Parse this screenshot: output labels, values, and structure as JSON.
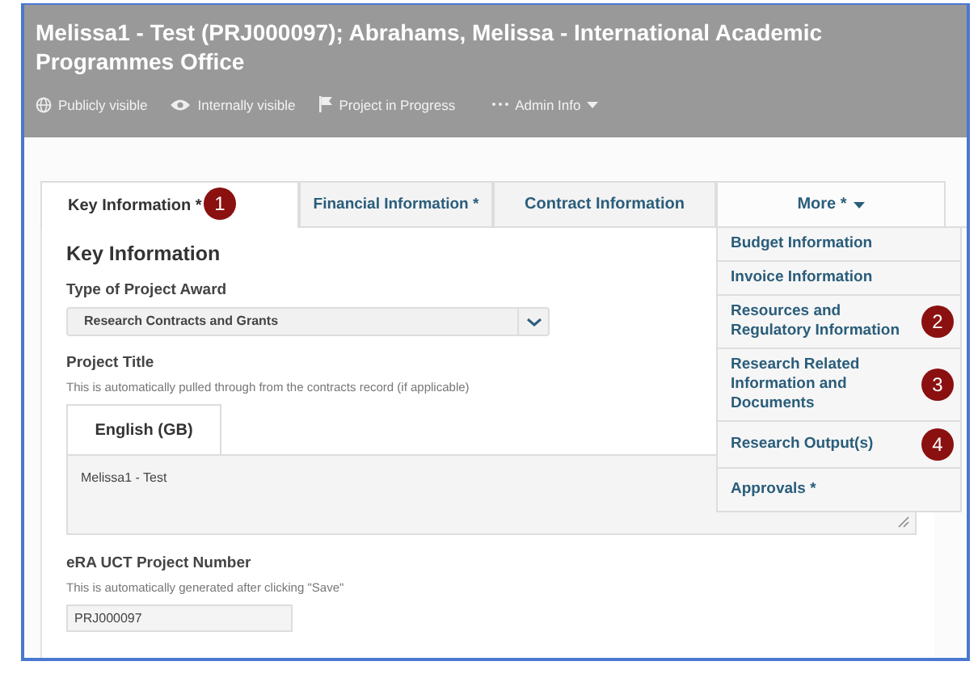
{
  "header": {
    "title": "Melissa1 - Test (PRJ000097); Abrahams, Melissa - International Academic Programmes Office",
    "meta": [
      {
        "kind": "globe",
        "label": "Publicly visible"
      },
      {
        "kind": "eye",
        "label": "Internally visible"
      },
      {
        "kind": "flag",
        "label": "Project in Progress"
      },
      {
        "kind": "menu",
        "label": "Admin Info"
      }
    ]
  },
  "tabs": [
    {
      "label": "Key Information *",
      "selected": true,
      "badge": "1"
    },
    {
      "label": "Financial Information *",
      "selected": false
    },
    {
      "label": "Contract Information",
      "selected": false
    },
    {
      "label": "More *",
      "selected": false,
      "kind": "dropdown",
      "expanded": true
    }
  ],
  "dropdown": [
    {
      "label": "Budget Information"
    },
    {
      "label": "Invoice Information"
    },
    {
      "label": "Resources and Regulatory Information",
      "badge": "2"
    },
    {
      "label": "Research Related Information and Documents",
      "badge": "3"
    },
    {
      "label": "Research Output(s)",
      "badge": "4"
    },
    {
      "label": "Approvals *"
    }
  ],
  "section": {
    "heading": "Key Information",
    "award": {
      "label": "Type of Project Award",
      "value": "Research Contracts and Grants"
    },
    "title": {
      "label": "Project Title",
      "hint": "This is automatically pulled through from the contracts record (if applicable)",
      "language": "English (GB)",
      "value": "Melissa1 - Test"
    },
    "number": {
      "label": "eRA UCT Project Number",
      "hint": "This is automatically generated after clicking \"Save\"",
      "value": "PRJ000097"
    }
  }
}
